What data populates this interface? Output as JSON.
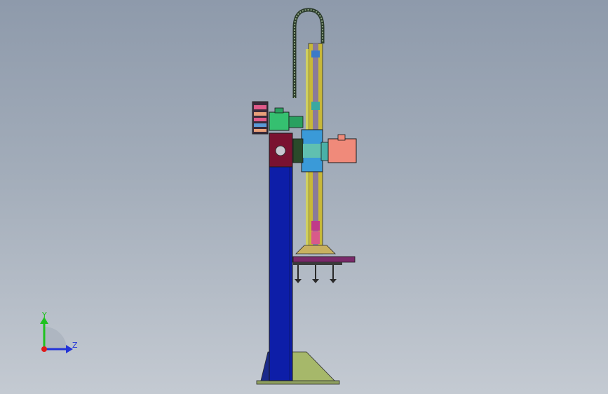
{
  "viewport": {
    "background_top": "#8e9aab",
    "background_bottom": "#c4cad2"
  },
  "triad": {
    "y_label": "Y",
    "z_label": "Z",
    "y_color": "#1fc21f",
    "z_color": "#2233d8",
    "x_color": "#e01b1b"
  },
  "model": {
    "column_color": "#0d1ea8",
    "base_color": "#a6b86a",
    "head_block_color": "#7a1230",
    "motor_color": "#f08a7a",
    "rail_color": "#c8b838",
    "cable_chain_color": "#2a3a2a"
  }
}
